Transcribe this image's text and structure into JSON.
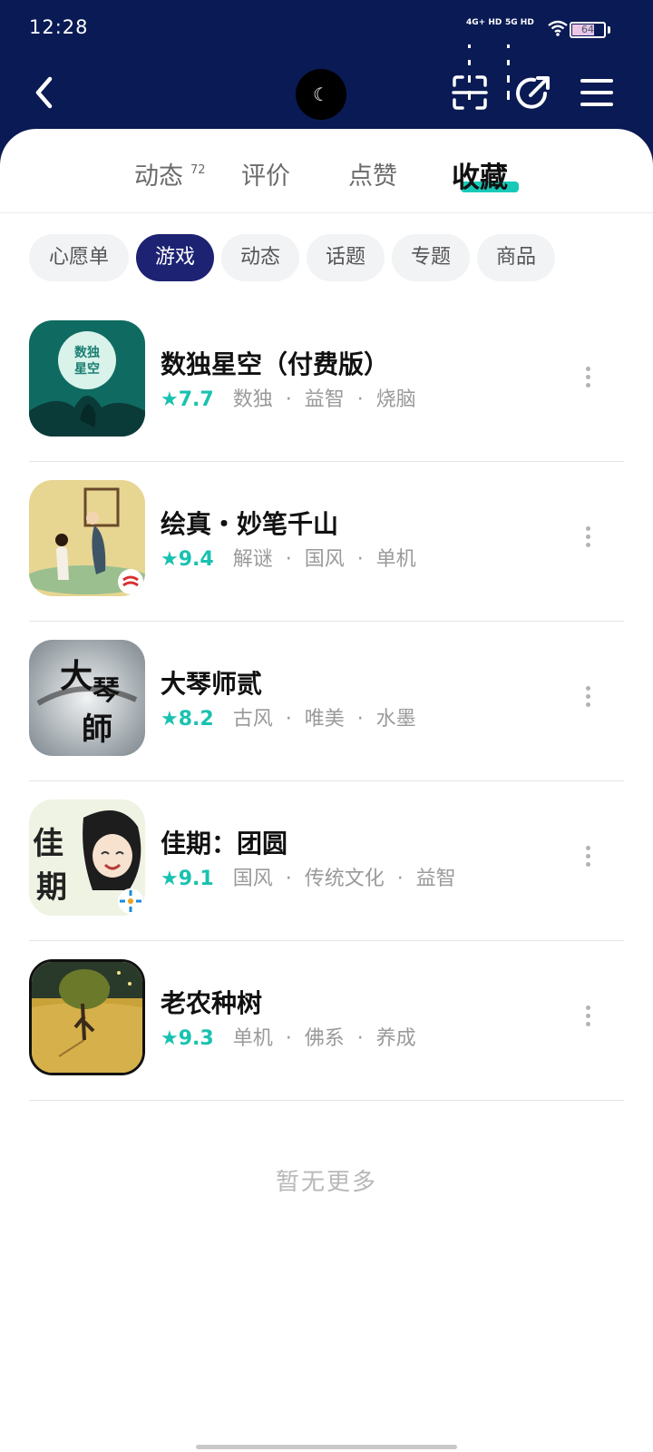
{
  "status_bar": {
    "time": "12:28",
    "sim1_label": "4G+ HD",
    "sim2_label": "5G HD",
    "battery": "64"
  },
  "nav": {
    "back_icon": "chevron-left-icon",
    "avatar_glyph": "☾",
    "scan_icon": "scan-icon",
    "share_icon": "share-icon",
    "menu_icon": "menu-icon"
  },
  "tabs": [
    {
      "label": "动态",
      "badge": "72"
    },
    {
      "label": "评价"
    },
    {
      "label": "点赞"
    },
    {
      "label": "收藏"
    }
  ],
  "chips": [
    "心愿单",
    "游戏",
    "动态",
    "话题",
    "专题",
    "商品"
  ],
  "games": [
    {
      "title": "数独星空（付费版）",
      "rating": "7.7",
      "tags": [
        "数独",
        "益智",
        "烧脑"
      ],
      "thumb_text": "数独\n星空"
    },
    {
      "title": "绘真・妙笔千山",
      "rating": "9.4",
      "tags": [
        "解谜",
        "国风",
        "单机"
      ]
    },
    {
      "title": "大琴师贰",
      "rating": "8.2",
      "tags": [
        "古风",
        "唯美",
        "水墨"
      ],
      "thumb_text": "大琴师"
    },
    {
      "title": "佳期：团圆",
      "rating": "9.1",
      "tags": [
        "国风",
        "传统文化",
        "益智"
      ],
      "thumb_text": "佳期"
    },
    {
      "title": "老农种树",
      "rating": "9.3",
      "tags": [
        "单机",
        "佛系",
        "养成"
      ]
    }
  ],
  "footer": {
    "no_more": "暂无更多"
  },
  "colors": {
    "header_bg": "#0a1a54",
    "accent": "#19c2b0",
    "chip_active": "#1d2273"
  }
}
